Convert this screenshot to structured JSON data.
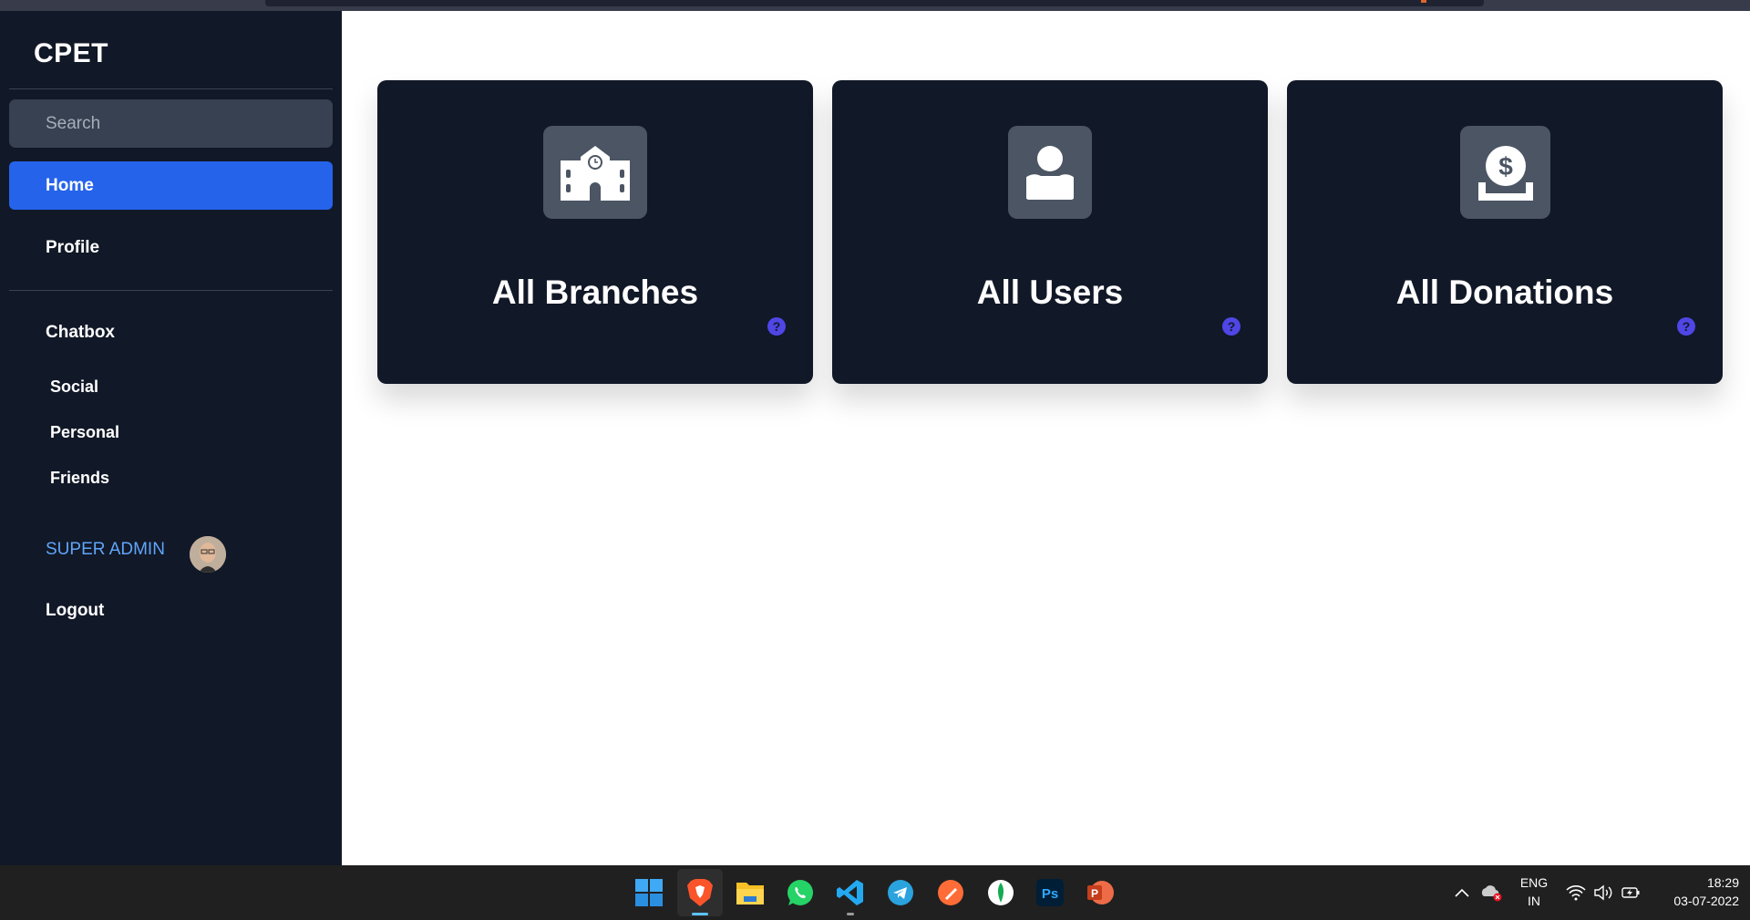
{
  "sidebar": {
    "brand": "CPET",
    "search_placeholder": "Search",
    "nav": {
      "home": "Home",
      "profile": "Profile",
      "chatbox": "Chatbox",
      "social": "Social",
      "personal": "Personal",
      "friends": "Friends",
      "admin": "SUPER ADMIN",
      "logout": "Logout"
    }
  },
  "cards": [
    {
      "title": "All Branches",
      "icon": "school-building-icon"
    },
    {
      "title": "All Users",
      "icon": "user-icon"
    },
    {
      "title": "All Donations",
      "icon": "hand-holding-dollar-icon"
    }
  ],
  "help_glyph": "?",
  "colors": {
    "sidebar_bg": "#111827",
    "active_nav": "#2563eb",
    "admin_text": "#60a5fa",
    "help_icon": "#4f46e5"
  },
  "taskbar": {
    "apps": [
      "windows-start-icon",
      "brave-browser-icon",
      "file-explorer-icon",
      "whatsapp-icon",
      "vscode-icon",
      "telegram-icon",
      "postman-icon",
      "mongodb-compass-icon",
      "photoshop-icon",
      "powerpoint-icon"
    ],
    "ps_label": "Ps",
    "pp_label": "P",
    "lang_top": "ENG",
    "lang_bottom": "IN",
    "time": "18:29",
    "date": "03-07-2022"
  }
}
